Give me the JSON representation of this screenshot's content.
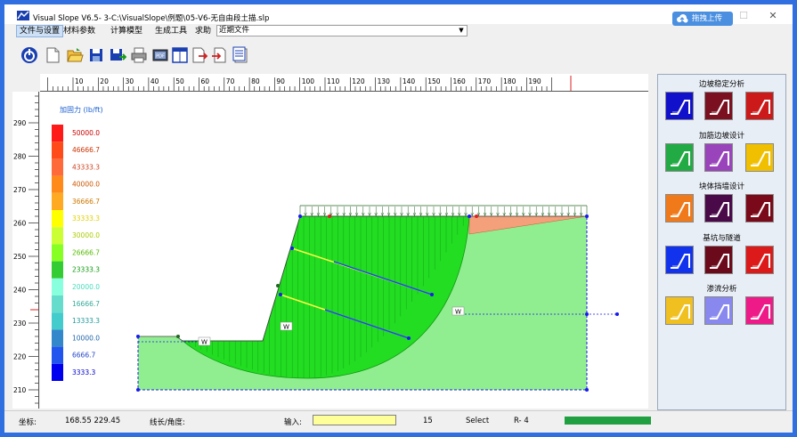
{
  "window": {
    "title": "Visual Slope V6.5- 3-C:\\VisualSlope\\例题\\05-V6-无自由段土描.slp",
    "minimize": "—",
    "maximize": "☐",
    "close": "✕"
  },
  "menu": {
    "items": [
      "文件与设置",
      "材料参数",
      "计算模型",
      "生成工具",
      "求助"
    ],
    "recent_files": "近期文件",
    "upload_button": "拖拽上传"
  },
  "toolbar": {
    "icons": [
      "power-icon",
      "new-file-icon",
      "open-folder-icon",
      "save-icon",
      "save-as-icon",
      "print-icon",
      "print-preview-icon",
      "window-icon",
      "export-icon",
      "import-icon",
      "notes-icon"
    ]
  },
  "rulers": {
    "horizontal": [
      "10",
      "20",
      "30",
      "40",
      "50",
      "60",
      "70",
      "80",
      "90",
      "100",
      "110",
      "120",
      "130",
      "140",
      "150",
      "160",
      "170",
      "180",
      "190"
    ],
    "vertical": [
      "290",
      "280",
      "270",
      "260",
      "250",
      "240",
      "230",
      "220",
      "210"
    ]
  },
  "legend": {
    "title": "加固力 (lb/ft)",
    "items": [
      {
        "value": "50000.0",
        "color": "#ff1a1a",
        "text_color": "#cc0000"
      },
      {
        "value": "46666.7",
        "color": "#ff4a1a",
        "text_color": "#cc3300"
      },
      {
        "value": "43333.3",
        "color": "#ff6a3a",
        "text_color": "#cc4422"
      },
      {
        "value": "40000.0",
        "color": "#ff8a1a",
        "text_color": "#cc5500"
      },
      {
        "value": "36666.7",
        "color": "#ffaa22",
        "text_color": "#cc7700"
      },
      {
        "value": "33333.3",
        "color": "#ffff00",
        "text_color": "#e0d000"
      },
      {
        "value": "30000.0",
        "color": "#ccff33",
        "text_color": "#aacc00"
      },
      {
        "value": "26666.7",
        "color": "#88ff22",
        "text_color": "#55bb00"
      },
      {
        "value": "23333.3",
        "color": "#33cc33",
        "text_color": "#119911"
      },
      {
        "value": "20000.0",
        "color": "#88ffdd",
        "text_color": "#44ddbb"
      },
      {
        "value": "16666.7",
        "color": "#66ddcc",
        "text_color": "#33aa99"
      },
      {
        "value": "13333.3",
        "color": "#44cccc",
        "text_color": "#229999"
      },
      {
        "value": "10000.0",
        "color": "#3388cc",
        "text_color": "#2266aa"
      },
      {
        "value": "6666.7",
        "color": "#2255ee",
        "text_color": "#2244cc"
      },
      {
        "value": "3333.3",
        "color": "#0000ee",
        "text_color": "#0000cc"
      }
    ]
  },
  "diagram": {
    "w_labels": [
      "W",
      "W",
      "W"
    ]
  },
  "panel": {
    "sections": [
      {
        "title": "边坡稳定分析",
        "tools": [
          {
            "name": "slope-stability-tool",
            "color": "#1111cc"
          },
          {
            "name": "slope-section-tool",
            "color": "#7a1020"
          },
          {
            "name": "slope-rainfall-tool",
            "color": "#cc1a1a"
          }
        ]
      },
      {
        "title": "加筋边坡设计",
        "tools": [
          {
            "name": "reinforced-slope-tool",
            "color": "#22aa44"
          },
          {
            "name": "geogrid-tool",
            "color": "#9944bb"
          },
          {
            "name": "reinforced-wall-tool",
            "color": "#f0c000"
          }
        ]
      },
      {
        "title": "块体挡墙设计",
        "tools": [
          {
            "name": "block-wall-tool",
            "color": "#f07a1a"
          },
          {
            "name": "block-stack-tool",
            "color": "#4a0a4a"
          },
          {
            "name": "block-step-tool",
            "color": "#7a0a1a"
          }
        ]
      },
      {
        "title": "基坑与隧道",
        "tools": [
          {
            "name": "frozen-soil-tool",
            "color": "#1133ee"
          },
          {
            "name": "excavation-tool",
            "color": "#6a0a1a"
          },
          {
            "name": "tunnel-tool",
            "color": "#dd1a1a"
          }
        ]
      },
      {
        "title": "渗流分析",
        "tools": [
          {
            "name": "seepage-dam-tool",
            "color": "#f0c020"
          },
          {
            "name": "seepage-flow-tool",
            "color": "#8888ee"
          },
          {
            "name": "seepage-wall-tool",
            "color": "#ee1a88"
          }
        ]
      }
    ]
  },
  "status": {
    "coord_label": "坐标:",
    "coord_value": "168.55  229.45",
    "line_label": "线长/角度:",
    "input_label": "输入:",
    "input_value": "",
    "count": "15",
    "mode": "Select",
    "radius": "R- 4",
    "progress": 1.0,
    "progress_color": "#20a040"
  }
}
